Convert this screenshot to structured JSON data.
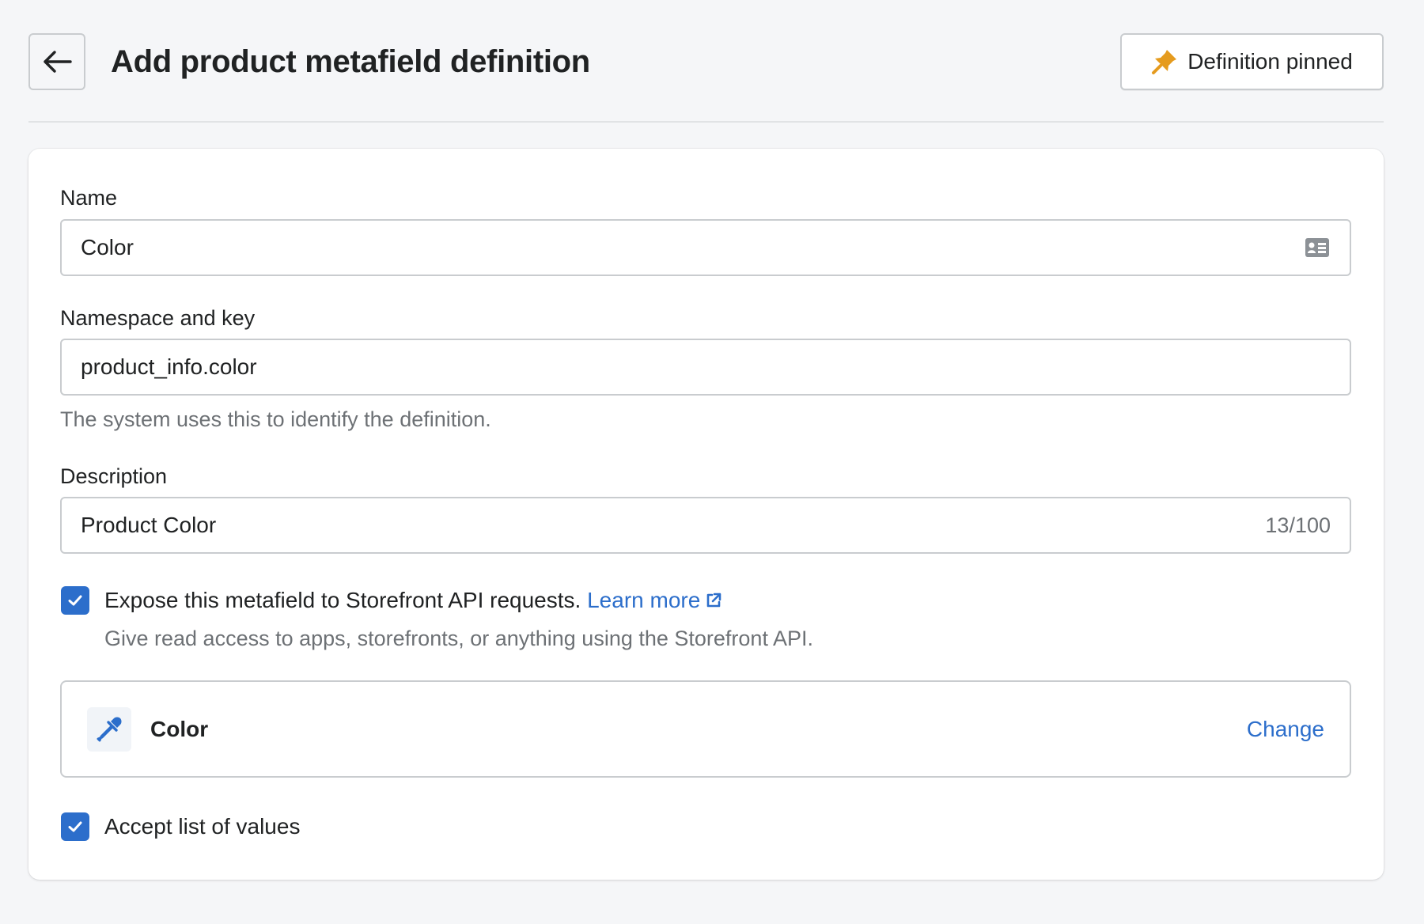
{
  "header": {
    "title": "Add product metafield definition",
    "pin_label": "Definition pinned",
    "back_icon": "arrow-left-icon",
    "pin_icon": "pin-icon"
  },
  "form": {
    "name": {
      "label": "Name",
      "value": "Color",
      "icon": "contact-card-icon"
    },
    "namespace": {
      "label": "Namespace and key",
      "value": "product_info.color",
      "help": "The system uses this to identify the definition."
    },
    "description": {
      "label": "Description",
      "value": "Product Color",
      "counter": "13/100"
    },
    "storefront": {
      "checked": true,
      "label": "Expose this metafield to Storefront API requests.",
      "link": "Learn more",
      "help": "Give read access to apps, storefronts, or anything using the Storefront API."
    },
    "type": {
      "icon": "eyedropper-icon",
      "name": "Color",
      "change_label": "Change"
    },
    "list_values": {
      "checked": true,
      "label": "Accept list of values"
    }
  },
  "colors": {
    "accent": "#2c6ecb",
    "pin": "#e59b1e",
    "border": "#c9cccf",
    "background": "#f5f6f8"
  }
}
